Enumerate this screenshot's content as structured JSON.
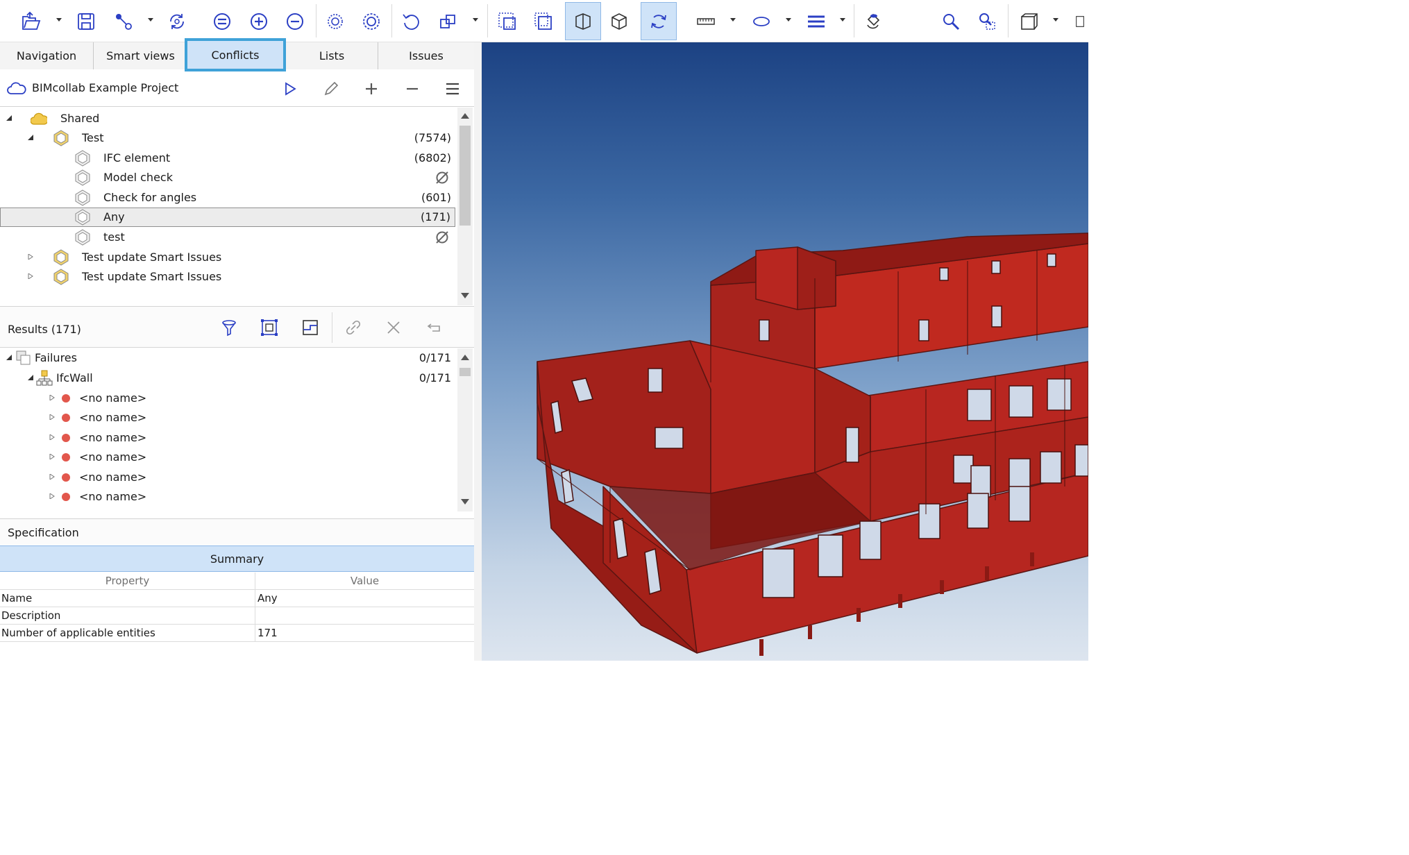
{
  "tabs": [
    "Navigation",
    "Smart views",
    "Conflicts",
    "Lists",
    "Issues"
  ],
  "selected_tab": "Conflicts",
  "project": {
    "title": "BIMcollab Example Project"
  },
  "tree": [
    {
      "label": "Shared",
      "count": "",
      "level": 0,
      "expanded": true,
      "icon": "cloud-icon"
    },
    {
      "label": "Test",
      "count": "(7574)",
      "level": 1,
      "expanded": true,
      "icon": "smart-issue-icon"
    },
    {
      "label": "IFC element",
      "count": "(6802)",
      "level": 2,
      "icon": "smart-issue-icon"
    },
    {
      "label": "Model check",
      "count": "",
      "level": 2,
      "icon": "smart-issue-icon",
      "empty": true
    },
    {
      "label": "Check for angles",
      "count": "(601)",
      "level": 2,
      "icon": "smart-issue-icon"
    },
    {
      "label": "Any",
      "count": "(171)",
      "level": 2,
      "icon": "smart-issue-icon",
      "selected": true
    },
    {
      "label": "test",
      "count": "",
      "level": 2,
      "icon": "smart-issue-icon",
      "empty": true
    },
    {
      "label": "Test update Smart Issues",
      "count": "",
      "level": 1,
      "collapsed": true,
      "icon": "smart-issue-icon"
    },
    {
      "label": "Test update Smart Issues",
      "count": "",
      "level": 1,
      "collapsed": true,
      "icon": "smart-issue-icon"
    }
  ],
  "results": {
    "title": "Results (171)",
    "rows": [
      {
        "label": "Failures",
        "count": "0/171",
        "level": 0
      },
      {
        "label": "IfcWall",
        "count": "0/171",
        "level": 1
      },
      {
        "label": "<no name>",
        "level": 2
      },
      {
        "label": "<no name>",
        "level": 2
      },
      {
        "label": "<no name>",
        "level": 2
      },
      {
        "label": "<no name>",
        "level": 2
      },
      {
        "label": "<no name>",
        "level": 2
      },
      {
        "label": "<no name>",
        "level": 2
      }
    ]
  },
  "specification": {
    "title": "Specification",
    "summary": "Summary",
    "headers": {
      "property": "Property",
      "value": "Value"
    },
    "rows": [
      {
        "property": "Name",
        "value": "Any"
      },
      {
        "property": "Description",
        "value": ""
      },
      {
        "property": "Number of applicable entities",
        "value": "171"
      }
    ]
  },
  "colors": {
    "accent": "#2b3fc4",
    "selection": "#cfe3f8",
    "failure_dot": "#e2574c",
    "building": "#b01e18"
  }
}
